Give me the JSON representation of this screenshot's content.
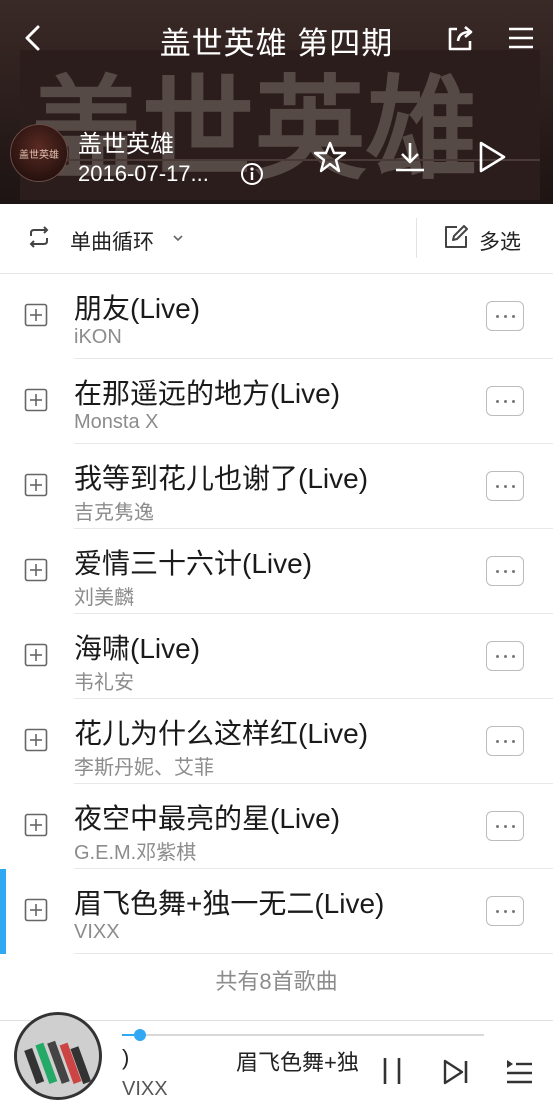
{
  "header": {
    "title": "盖世英雄 第四期",
    "banner_text": "盖世英雄",
    "cover_text": "盖世英雄",
    "album_name": "盖世英雄",
    "album_date": "2016-07-17...",
    "icons": [
      "back-icon",
      "share-icon",
      "menu-icon",
      "info-icon",
      "star-icon",
      "download-icon",
      "play-icon"
    ]
  },
  "toolbar": {
    "loop_label": "单曲循环",
    "multi_select_label": "多选",
    "icons": [
      "loop-icon",
      "chevron-down-icon",
      "edit-icon"
    ]
  },
  "songs": [
    {
      "title": "朋友(Live)",
      "artist": "iKON"
    },
    {
      "title": "在那遥远的地方(Live)",
      "artist": "Monsta X"
    },
    {
      "title": "我等到花儿也谢了(Live)",
      "artist": "吉克隽逸"
    },
    {
      "title": "爱情三十六计(Live)",
      "artist": "刘美麟"
    },
    {
      "title": "海啸(Live)",
      "artist": "韦礼安"
    },
    {
      "title": "花儿为什么这样红(Live)",
      "artist": "李斯丹妮、艾菲"
    },
    {
      "title": "夜空中最亮的星(Live)",
      "artist": "G.E.M.邓紫棋"
    },
    {
      "title": "眉飞色舞+独一无二(Live)",
      "artist": "VIXX"
    }
  ],
  "active_index": 7,
  "footer": {
    "count_text": "共有8首歌曲"
  },
  "player": {
    "marquee_a": ")",
    "marquee_b": "眉飞色舞+独",
    "artist": "VIXX",
    "progress": 0.05,
    "icons": [
      "pause-icon",
      "next-icon",
      "queue-icon"
    ]
  },
  "colors": {
    "accent": "#31a8f3",
    "header_bg": "#2a1d1b"
  }
}
